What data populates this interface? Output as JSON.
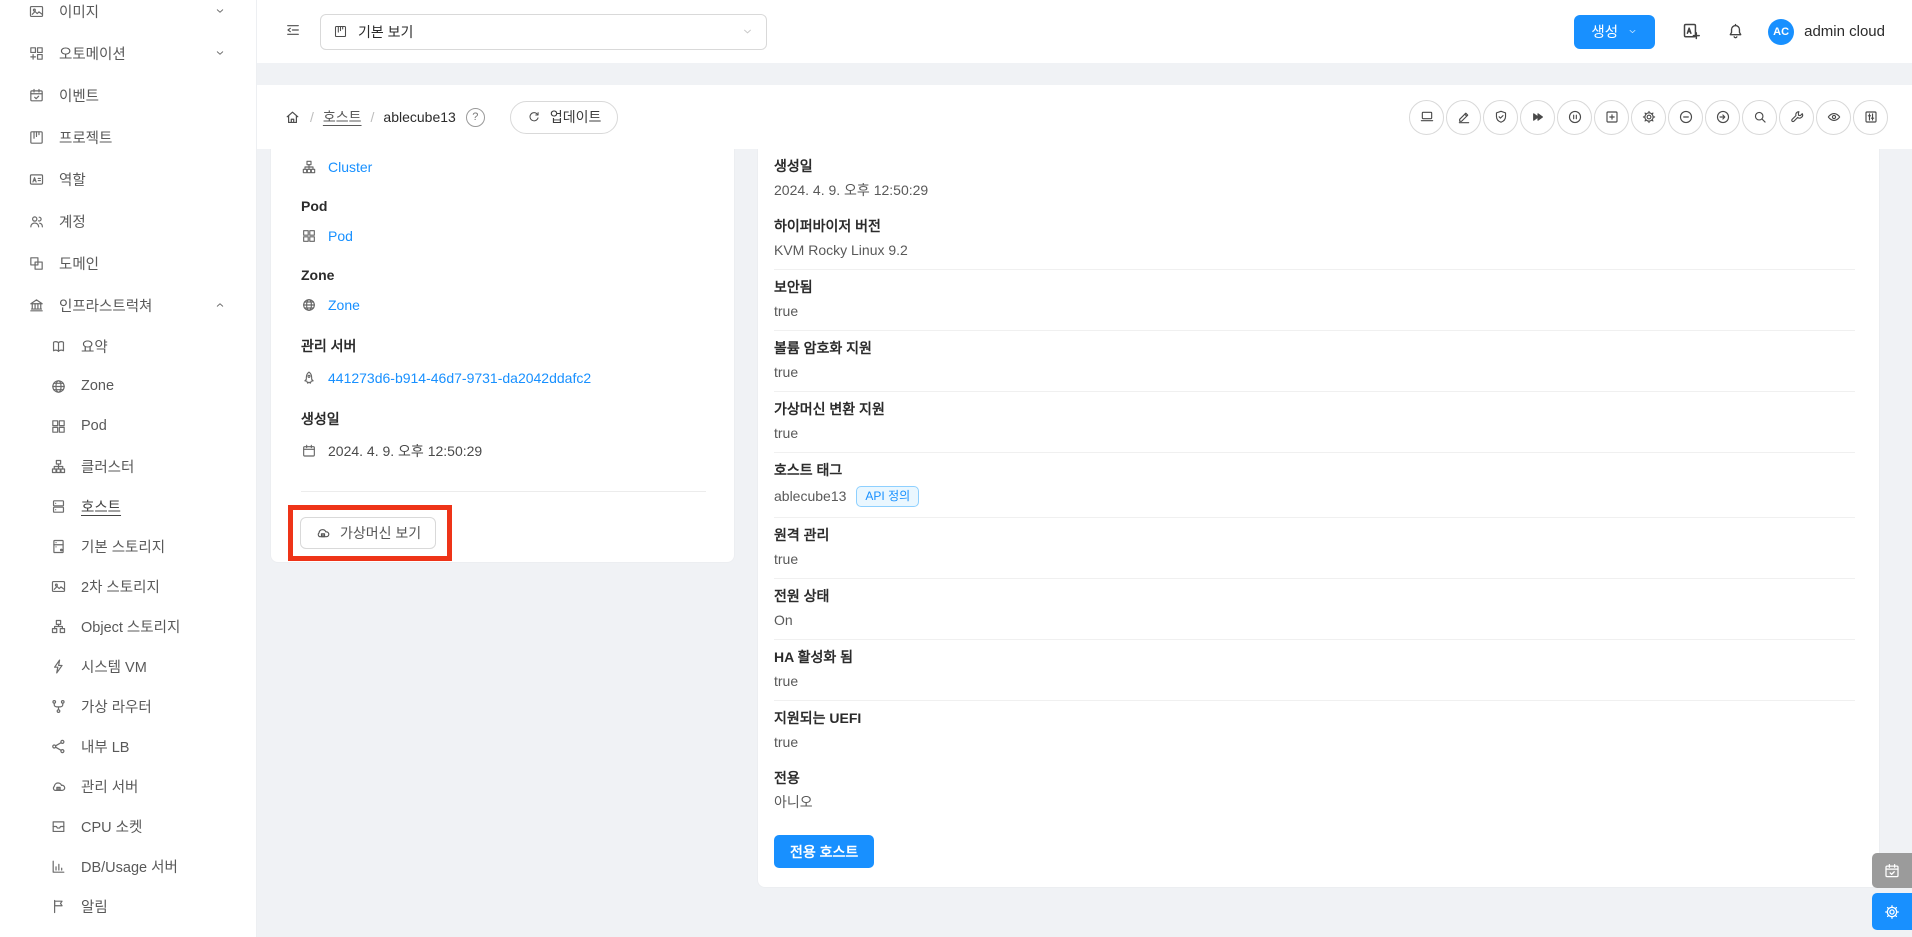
{
  "colors": {
    "accent": "#1890ff",
    "annotation_red": "#ee3418",
    "badge_bg": "#eaf7ff",
    "badge_border": "#8ed0ff"
  },
  "topbar": {
    "view_select": {
      "icon": "project",
      "value": "기본 보기"
    },
    "create_button": {
      "label": "생성"
    },
    "user": {
      "initials": "AC",
      "name": "admin cloud"
    }
  },
  "breadcrumb": {
    "separator": "/",
    "items": [
      "호스트",
      "ablecube13"
    ],
    "help_text": "?",
    "update_button": {
      "icon": "reload",
      "label": "업데이트"
    }
  },
  "page_actions": [
    {
      "icon": "laptop"
    },
    {
      "icon": "edit"
    },
    {
      "icon": "shield-check"
    },
    {
      "icon": "forward"
    },
    {
      "icon": "pause-circle"
    },
    {
      "icon": "plus-square"
    },
    {
      "icon": "gear"
    },
    {
      "icon": "minus-circle"
    },
    {
      "icon": "arrow-circle"
    },
    {
      "icon": "search"
    },
    {
      "icon": "wrench"
    },
    {
      "icon": "eye"
    },
    {
      "icon": "sliders"
    }
  ],
  "sidebar": {
    "items": [
      {
        "id": "images",
        "label": "이미지",
        "icon": "picture",
        "chevron": "down"
      },
      {
        "id": "automation",
        "label": "오토메이션",
        "icon": "automation",
        "chevron": "down"
      },
      {
        "id": "events",
        "label": "이벤트",
        "icon": "calendar-check"
      },
      {
        "id": "projects",
        "label": "프로젝트",
        "icon": "project"
      },
      {
        "id": "roles",
        "label": "역할",
        "icon": "role"
      },
      {
        "id": "accounts",
        "label": "계정",
        "icon": "team"
      },
      {
        "id": "domains",
        "label": "도메인",
        "icon": "domain"
      },
      {
        "id": "infrastructure",
        "label": "인프라스트럭쳐",
        "icon": "bank",
        "chevron": "up"
      },
      {
        "id": "summary",
        "label": "요약",
        "icon": "book",
        "sub": true
      },
      {
        "id": "zone",
        "label": "Zone",
        "icon": "globe",
        "sub": true
      },
      {
        "id": "pod",
        "label": "Pod",
        "icon": "grid",
        "sub": true
      },
      {
        "id": "cluster",
        "label": "클러스터",
        "icon": "cluster",
        "sub": true
      },
      {
        "id": "host",
        "label": "호스트",
        "icon": "server",
        "sub": true,
        "selected": true
      },
      {
        "id": "primary-storage",
        "label": "기본 스토리지",
        "icon": "storage",
        "sub": true
      },
      {
        "id": "secondary-storage",
        "label": "2차 스토리지",
        "icon": "picture",
        "sub": true
      },
      {
        "id": "object-storage",
        "label": "Object 스토리지",
        "icon": "tree",
        "sub": true
      },
      {
        "id": "system-vm",
        "label": "시스템 VM",
        "icon": "bolt",
        "sub": true
      },
      {
        "id": "virtual-router",
        "label": "가상 라우터",
        "icon": "branch",
        "sub": true
      },
      {
        "id": "internal-lb",
        "label": "내부 LB",
        "icon": "share",
        "sub": true
      },
      {
        "id": "management-server",
        "label": "관리 서버",
        "icon": "cloud-server",
        "sub": true
      },
      {
        "id": "cpu-socket",
        "label": "CPU 소켓",
        "icon": "inbox",
        "sub": true
      },
      {
        "id": "db-usage",
        "label": "DB/Usage 서버",
        "icon": "bar-chart",
        "sub": true
      },
      {
        "id": "alerts",
        "label": "알림",
        "icon": "flag",
        "sub": true
      }
    ]
  },
  "overview_card": {
    "sections": [
      {
        "link": "Cluster",
        "icon": "cluster"
      },
      {
        "label": "Pod",
        "link": "Pod",
        "icon": "grid"
      },
      {
        "label": "Zone",
        "link": "Zone",
        "icon": "globe"
      },
      {
        "label": "관리 서버",
        "link": "441273d6-b914-46d7-9731-da2042ddafc2",
        "icon": "rocket"
      },
      {
        "label": "생성일",
        "text": "2024. 4. 9. 오후 12:50:29",
        "icon": "calendar"
      }
    ],
    "vm_view_button": {
      "icon": "cloud-server",
      "label": "가상머신 보기"
    }
  },
  "details_card": {
    "rows": [
      {
        "label": "생성일",
        "value": "2024. 4. 9. 오후 12:50:29",
        "divider": false
      },
      {
        "label": "하이퍼바이저 버전",
        "value": "KVM Rocky Linux 9.2",
        "divider": true
      },
      {
        "label": "보안됨",
        "value": "true",
        "divider": true
      },
      {
        "label": "볼륨 암호화 지원",
        "value": "true",
        "divider": true
      },
      {
        "label": "가상머신 변환 지원",
        "value": "true",
        "divider": true
      },
      {
        "label": "호스트 태그",
        "value": "ablecube13",
        "badge": "API 정의",
        "divider": true
      },
      {
        "label": "원격 관리",
        "value": "true",
        "divider": true
      },
      {
        "label": "전원 상태",
        "value": "On",
        "divider": true
      },
      {
        "label": "HA 활성화 됨",
        "value": "true",
        "divider": true
      },
      {
        "label": "지원되는 UEFI",
        "value": "true",
        "divider": false
      },
      {
        "label": "전용",
        "value": "아니오",
        "divider": false
      }
    ],
    "dedicate_button": "전용 호스트"
  },
  "floating_buttons": [
    {
      "icon": "calendar-check"
    },
    {
      "icon": "gear"
    }
  ]
}
